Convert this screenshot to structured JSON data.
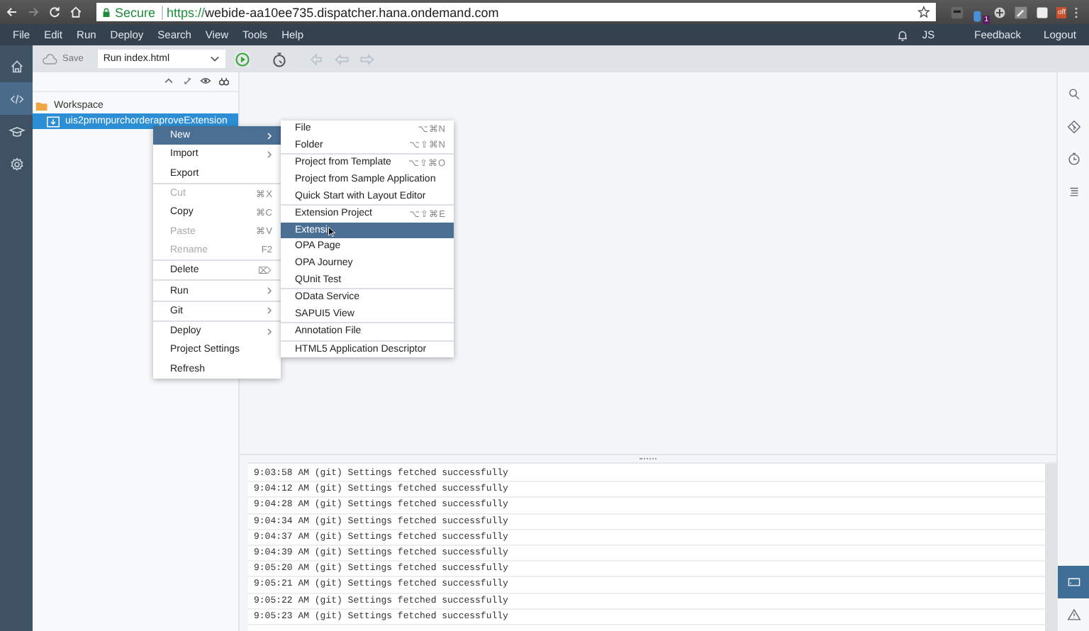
{
  "browser": {
    "security": "Secure",
    "url_scheme": "https://",
    "url_rest": "webide-aa10ee735.dispatcher.hana.ondemand.com",
    "extension_badge": "1",
    "extension_label": "off"
  },
  "menu_bar": {
    "items": [
      "File",
      "Edit",
      "Run",
      "Deploy",
      "Search",
      "View",
      "Tools",
      "Help"
    ],
    "user": "JS",
    "links": [
      "Feedback",
      "Logout"
    ]
  },
  "toolbar": {
    "save": "Save",
    "run_config": "Run index.html"
  },
  "left_rail": [
    {
      "selected": false
    },
    {
      "selected": true
    },
    {
      "selected": false
    },
    {
      "selected": false
    }
  ],
  "right_rail_bottom": [
    {
      "selected": true
    },
    {
      "selected": false
    }
  ],
  "workspace": {
    "root": "Workspace",
    "children": [
      {
        "label": "uis2pmmpurchorderaproveExtension",
        "selected": true
      }
    ]
  },
  "context_menu": [
    [
      {
        "label": "New",
        "submenu": true,
        "disabled": false,
        "selected": true
      },
      {
        "label": "Import",
        "submenu": true,
        "disabled": false,
        "selected": false
      },
      {
        "label": "Export",
        "disabled": false,
        "selected": false
      }
    ],
    [
      {
        "label": "Cut",
        "shortcut": "⌘X",
        "disabled": true,
        "selected": false
      },
      {
        "label": "Copy",
        "shortcut": "⌘C",
        "disabled": false,
        "selected": false
      },
      {
        "label": "Paste",
        "shortcut": "⌘V",
        "disabled": true,
        "selected": false
      },
      {
        "label": "Rename",
        "shortcut": "F2",
        "disabled": true,
        "selected": false
      }
    ],
    [
      {
        "label": "Delete",
        "shortcut": "⌦",
        "disabled": false,
        "selected": false
      }
    ],
    [
      {
        "label": "Run",
        "submenu": true,
        "disabled": false,
        "selected": false
      }
    ],
    [
      {
        "label": "Git",
        "submenu": true,
        "disabled": false,
        "selected": false
      }
    ],
    [
      {
        "label": "Deploy",
        "submenu": true,
        "disabled": false,
        "selected": false
      },
      {
        "label": "Project Settings",
        "disabled": false,
        "selected": false
      },
      {
        "label": "Refresh",
        "disabled": false,
        "selected": false
      }
    ]
  ],
  "new_submenu": [
    [
      {
        "label": "File",
        "shortcut": "⌥⌘N",
        "selected": false
      },
      {
        "label": "Folder",
        "shortcut": "⌥⇧⌘N",
        "selected": false
      }
    ],
    [
      {
        "label": "Project from Template",
        "shortcut": "⌥⇧⌘O",
        "selected": false
      },
      {
        "label": "Project from Sample Application",
        "selected": false
      },
      {
        "label": "Quick Start with Layout Editor",
        "selected": false
      }
    ],
    [
      {
        "label": "Extension Project",
        "shortcut": "⌥⇧⌘E",
        "selected": false
      },
      {
        "label": "Extensi",
        "selected": true
      },
      {
        "label": "OPA Page",
        "selected": false
      },
      {
        "label": "OPA Journey",
        "selected": false
      },
      {
        "label": "QUnit Test",
        "selected": false
      }
    ],
    [
      {
        "label": "OData Service",
        "selected": false
      },
      {
        "label": "SAPUI5 View",
        "selected": false
      }
    ],
    [
      {
        "label": "Annotation File",
        "selected": false
      }
    ],
    [
      {
        "label": "HTML5 Application Descriptor",
        "selected": false
      }
    ]
  ],
  "console": [
    "9:03:58 AM (git) Settings fetched successfully",
    "9:04:12 AM (git) Settings fetched successfully",
    "9:04:28 AM (git) Settings fetched successfully",
    "9:04:34 AM (git) Settings fetched successfully",
    "9:04:37 AM (git) Settings fetched successfully",
    "9:04:39 AM (git) Settings fetched successfully",
    "9:05:20 AM (git) Settings fetched successfully",
    "9:05:21 AM (git) Settings fetched successfully",
    "9:05:22 AM (git) Settings fetched successfully",
    "9:05:23 AM (git) Settings fetched successfully"
  ]
}
